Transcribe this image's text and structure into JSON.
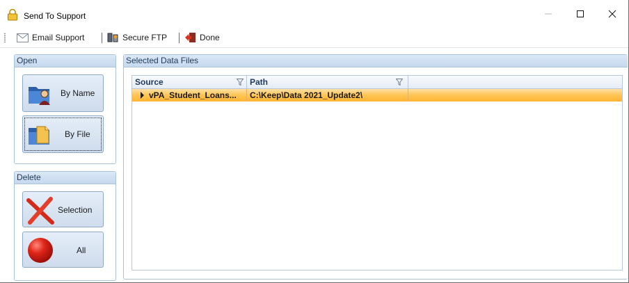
{
  "window": {
    "title": "Send To Support",
    "controls": [
      "minimize-icon",
      "maximize-icon",
      "close-icon"
    ]
  },
  "toolbar": {
    "email_label": "Email Support",
    "ftp_label": "Secure FTP",
    "done_label": "Done"
  },
  "open_panel": {
    "title": "Open",
    "by_name_label": "By Name",
    "by_file_label": "By File"
  },
  "delete_panel": {
    "title": "Delete",
    "selection_label": "Selection",
    "all_label": "All"
  },
  "files_panel": {
    "title": "Selected Data Files",
    "columns": [
      "Source",
      "Path"
    ],
    "rows": [
      {
        "source": "vPA_Student_Loans...",
        "path": "C:\\Keep\\Data 2021_Update2\\"
      }
    ]
  },
  "colors": {
    "panel_header": "#c6d9ee",
    "selected_row": "#ffc24d",
    "button_bg": "#d6e2f0"
  }
}
